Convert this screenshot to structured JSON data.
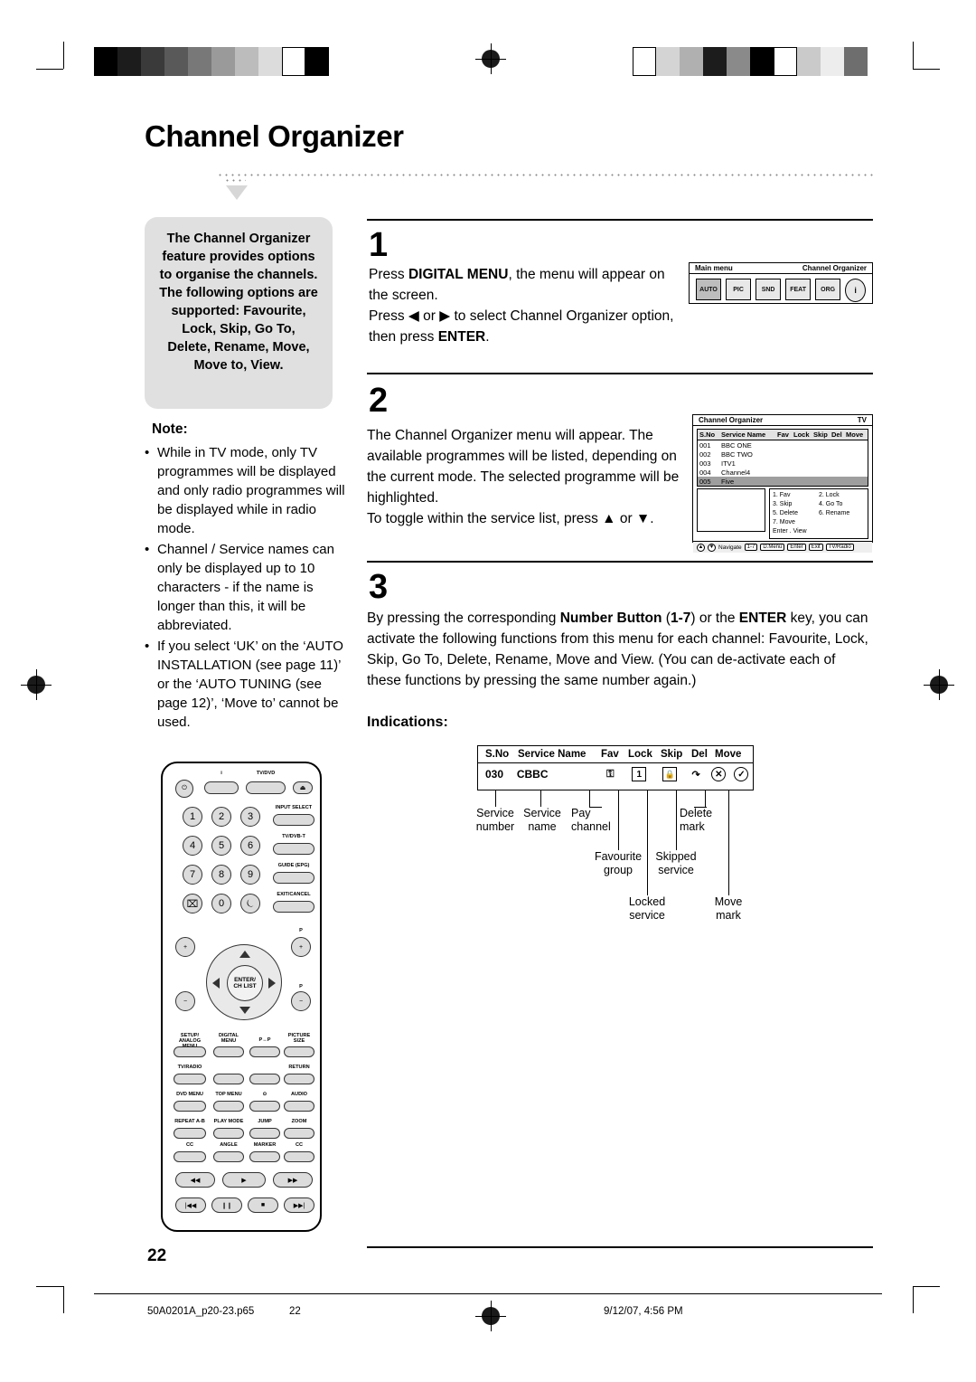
{
  "document": {
    "title": "Channel Organizer",
    "page_number": "22",
    "footer": {
      "file": "50A0201A_p20-23.p65",
      "page": "22",
      "timestamp": "9/12/07, 4:56 PM"
    }
  },
  "intro_box": {
    "text": "The Channel Organizer feature provides options to organise the channels. The following options are supported: Favourite, Lock, Skip, Go To, Delete, Rename, Move, Move to, View."
  },
  "note": {
    "heading": "Note:",
    "items": [
      "While in TV mode, only TV programmes will be displayed and only radio programmes will be displayed while in radio mode.",
      "Channel / Service names can only be displayed up to 10 characters - if the name is longer than this, it will be abbreviated.",
      "If you select ‘UK’ on the ‘AUTO INSTALLATION (see page 11)’ or the ‘AUTO TUNING (see page 12)’, ‘Move to’ cannot be used."
    ]
  },
  "steps": [
    {
      "number": "1",
      "lines": [
        "Press DIGITAL MENU, the menu will appear on the screen.",
        "Press ◀ or ▶ to select Channel Organizer option, then press ENTER."
      ]
    },
    {
      "number": "2",
      "lines": [
        "The Channel Organizer menu will appear. The available programmes will be listed, depending on the current mode. The selected programme will be highlighted.",
        "To toggle within the service list, press ▲ or ▼."
      ]
    },
    {
      "number": "3",
      "lines": [
        "By pressing the corresponding Number Button (1-7) or the ENTER key, you can activate the following functions from this menu for each channel: Favourite, Lock, Skip, Go To, Delete, Rename, Move and View. (You can de-activate each of these functions by pressing the same number again.)"
      ]
    }
  ],
  "osd_main_menu": {
    "left_label": "Main menu",
    "right_label": "Channel Organizer",
    "icons": [
      {
        "name": "auto-installation-icon",
        "glyph": "AUTO"
      },
      {
        "name": "picture-setup-icon",
        "glyph": "PIC"
      },
      {
        "name": "sound-setup-icon",
        "glyph": "SND"
      },
      {
        "name": "feature-setup-icon",
        "glyph": "FEAT"
      },
      {
        "name": "channel-organizer-icon",
        "glyph": "ORG"
      },
      {
        "name": "info-icon",
        "glyph": "i"
      }
    ]
  },
  "osd_channel_organizer": {
    "left_label": "Channel Organizer",
    "right_label": "TV",
    "columns": [
      "S.No",
      "Service Name",
      "Fav",
      "Lock",
      "Skip",
      "Del",
      "Move"
    ],
    "rows": [
      {
        "sno": "001",
        "name": "BBC ONE"
      },
      {
        "sno": "002",
        "name": "BBC TWO"
      },
      {
        "sno": "003",
        "name": "ITV1"
      },
      {
        "sno": "004",
        "name": "Channel4"
      },
      {
        "sno": "005",
        "name": "Five",
        "highlight": true
      }
    ],
    "functions": [
      "1. Fav",
      "2. Lock",
      "3. Skip",
      "4. Go To",
      "5. Delete",
      "6. Rename",
      "7. Move",
      "",
      "Enter . View",
      ""
    ],
    "bottom_bar": [
      {
        "key": "▲▼",
        "label": "Navigate"
      },
      {
        "key": "1-7",
        "label": ""
      },
      {
        "key": "D.Menu",
        "label": ""
      },
      {
        "key": "Enter",
        "label": ""
      },
      {
        "key": "Exit",
        "label": ""
      },
      {
        "key": "TV/Radio",
        "label": ""
      }
    ]
  },
  "indications": {
    "heading": "Indications:",
    "columns": [
      "S.No",
      "Service Name",
      "Fav",
      "Lock",
      "Skip",
      "Del",
      "Move"
    ],
    "row": {
      "sno": "030",
      "name": "CBBC",
      "pay_channel_symbol": "⚿",
      "favourite_symbol": "1",
      "locked_symbol": "🔒",
      "skipped_symbol": "↷",
      "delete_symbol": "✕",
      "move_symbol": "✓"
    },
    "callouts": [
      "Service number",
      "Service name",
      "Pay channel",
      "Delete mark",
      "Favourite group",
      "Skipped service",
      "Locked service",
      "Move mark"
    ]
  },
  "remote": {
    "name": "remote-control-illustration",
    "top_buttons": [
      "⏻",
      "i",
      "TV/DVD",
      "⏏"
    ],
    "numbers": [
      "1",
      "2",
      "3",
      "4",
      "5",
      "6",
      "7",
      "8",
      "9",
      "⌧",
      "0",
      "⏾"
    ],
    "side_labels": [
      "INPUT SELECT",
      "TV/DVB-T",
      "GUIDE (EPG)",
      "EXIT/CANCEL"
    ],
    "dpad_center": [
      "ENTER/",
      "CH LIST"
    ],
    "vol_label": "+ / −",
    "prog_label": "P",
    "function_rows": [
      [
        "SETUP/ ANALOG MENU",
        "DIGITAL MENU",
        "P↔P",
        "PICTURE SIZE"
      ],
      [
        "TV/RADIO",
        "",
        "",
        "RETURN"
      ],
      [
        "DVD MENU",
        "TOP MENU",
        "⊙",
        "AUDIO"
      ],
      [
        "REPEAT A-B",
        "PLAY MODE",
        "JUMP",
        "ZOOM"
      ],
      [
        "CC",
        "ANGLE",
        "MARKER",
        "CC"
      ]
    ],
    "transport_row1": [
      "◀◀",
      "▶",
      "▶▶"
    ],
    "transport_row2": [
      "|◀◀",
      "❙❙",
      "■",
      "▶▶|"
    ]
  }
}
